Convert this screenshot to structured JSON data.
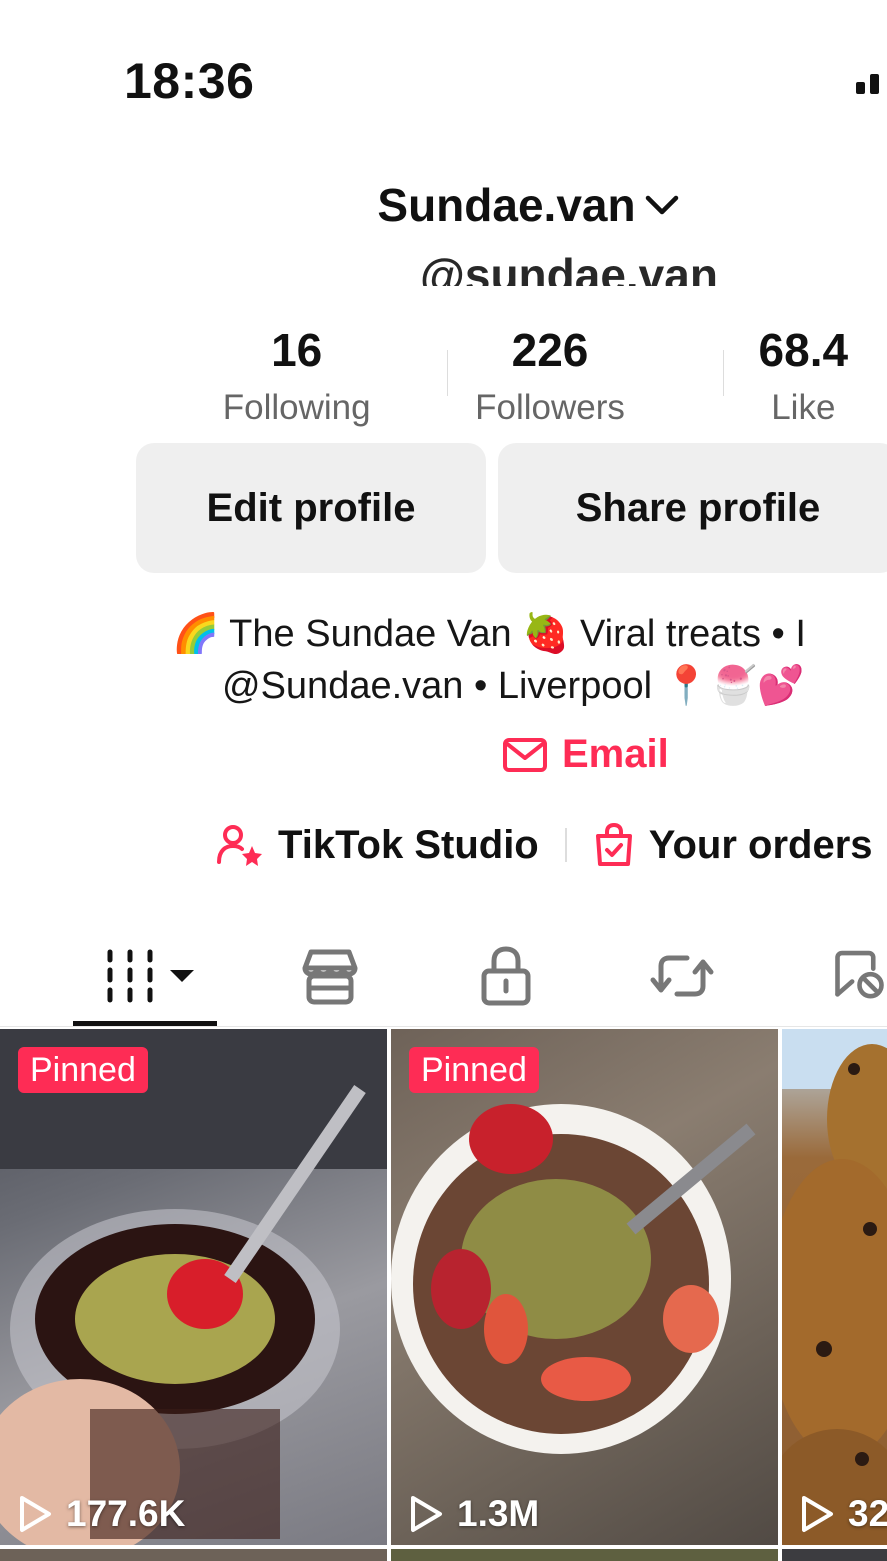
{
  "status_bar": {
    "time": "18:36"
  },
  "profile": {
    "username": "Sundae.van",
    "handle": "@sundae.van",
    "stats": [
      {
        "value": "16",
        "label": "Following"
      },
      {
        "value": "226",
        "label": "Followers"
      },
      {
        "value": "68.4",
        "label": "Like"
      }
    ],
    "buttons": {
      "edit": "Edit profile",
      "share": "Share profile"
    },
    "bio": {
      "line1": "🌈 The Sundae Van 🍓 Viral treats • I",
      "line2": "@Sundae.van • Liverpool 📍🍧💕"
    },
    "email_label": "Email",
    "links": {
      "studio": "TikTok Studio",
      "orders": "Your orders"
    }
  },
  "tabs": [
    "videos-tab",
    "shop-tab",
    "private-tab",
    "reposts-tab",
    "liked-tab"
  ],
  "videos": [
    {
      "pinned": "Pinned",
      "views": "177.6K"
    },
    {
      "pinned": "Pinned",
      "views": "1.3M"
    },
    {
      "pinned": "",
      "views": "32"
    }
  ],
  "colors": {
    "accent": "#fe2c55",
    "button_bg": "#efefef"
  }
}
